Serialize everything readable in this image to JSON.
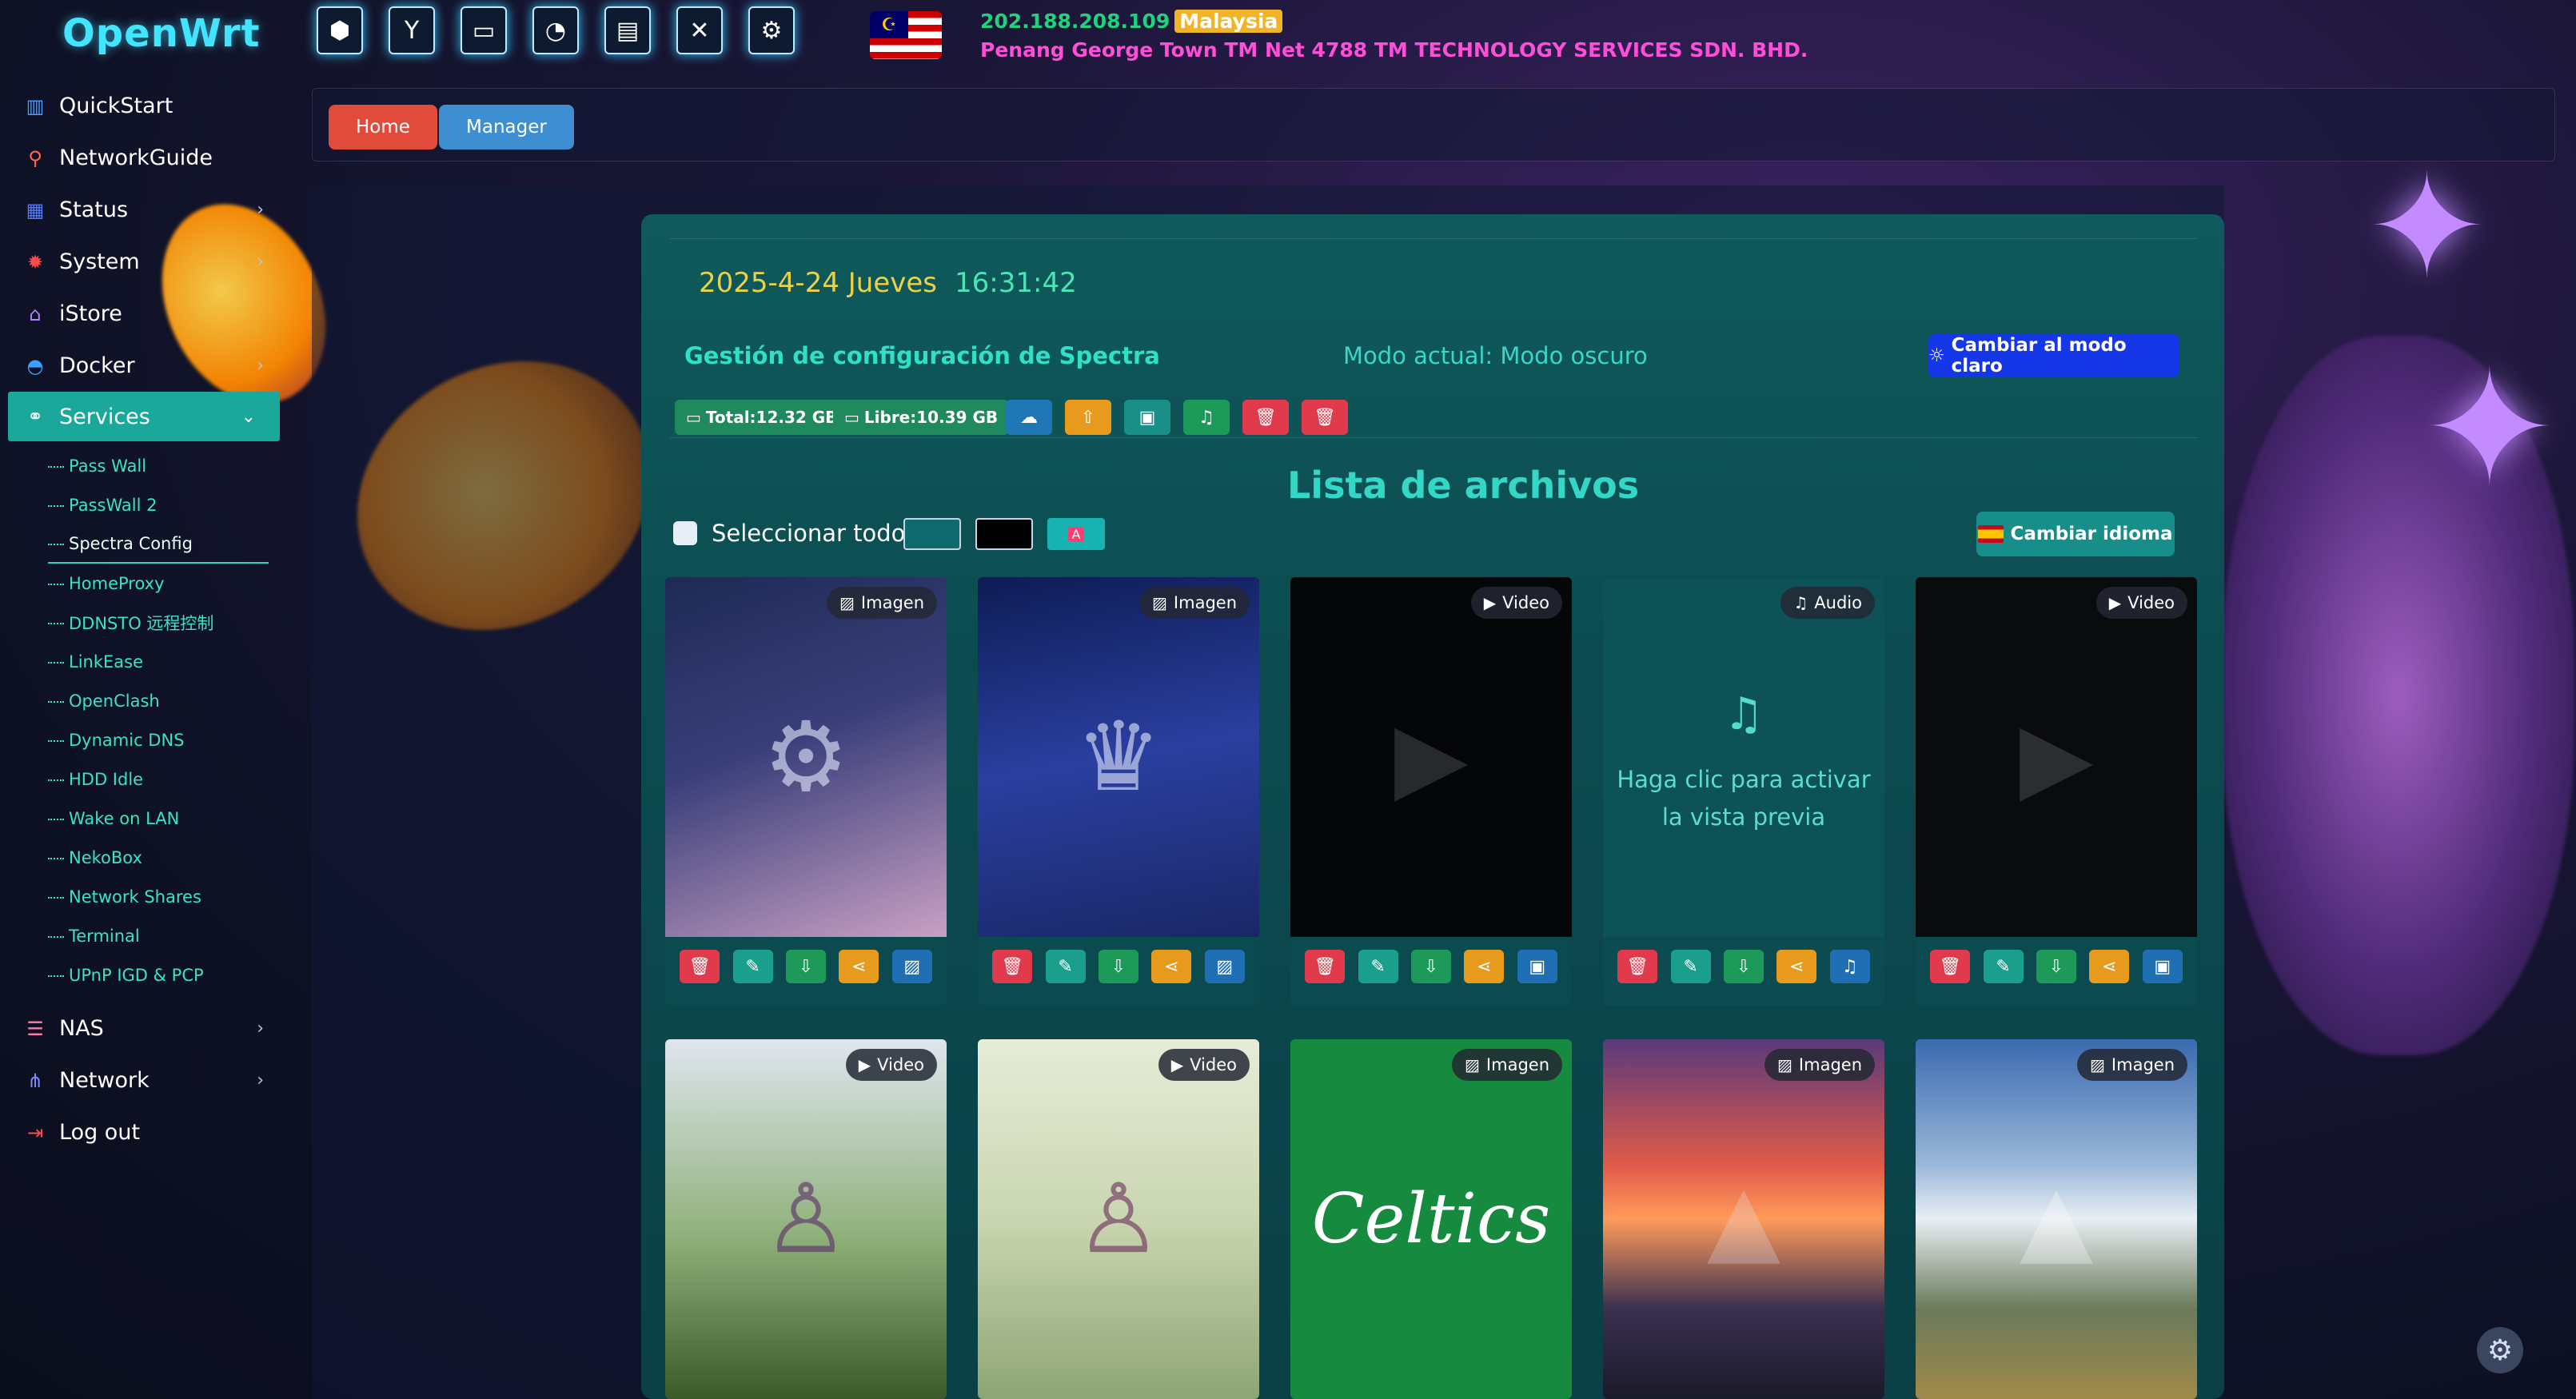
{
  "brand": "OpenWrt",
  "quick_icons": [
    "chart-icon",
    "yacd-icon",
    "folder-icon",
    "speed-icon",
    "window-icon",
    "tools-icon",
    "gear-icon"
  ],
  "ip_info": {
    "ip": "202.188.208.109",
    "country": "Malaysia",
    "isp": "Penang George Town TM Net 4788 TM TECHNOLOGY SERVICES SDN. BHD."
  },
  "sidebar": {
    "items": [
      {
        "label": "QuickStart",
        "icon": "dashboard-icon"
      },
      {
        "label": "NetworkGuide",
        "icon": "guide-icon"
      },
      {
        "label": "Status",
        "icon": "grid-icon"
      },
      {
        "label": "System",
        "icon": "cog-icon"
      },
      {
        "label": "iStore",
        "icon": "store-icon"
      },
      {
        "label": "Docker",
        "icon": "docker-icon"
      },
      {
        "label": "Services",
        "icon": "services-icon"
      },
      {
        "label": "NAS",
        "icon": "database-icon"
      },
      {
        "label": "Network",
        "icon": "network-icon"
      },
      {
        "label": "Log out",
        "icon": "logout-icon"
      }
    ],
    "services_sub": [
      "Pass Wall",
      "PassWall 2",
      "Spectra Config",
      "HomeProxy",
      "DDNSTO 远程控制",
      "LinkEase",
      "OpenClash",
      "Dynamic DNS",
      "HDD Idle",
      "Wake on LAN",
      "NekoBox",
      "Network Shares",
      "Terminal",
      "UPnP IGD & PCP"
    ]
  },
  "breadcrumb": {
    "home": "Home",
    "manager": "Manager"
  },
  "panel": {
    "date": "2025-4-24 Jueves",
    "time": "16:31:42",
    "config_title": "Gestión de configuración de Spectra",
    "mode_text": "Modo actual: Modo oscuro",
    "light_mode_button": "Cambiar al modo claro",
    "total_badge": "Total:12.32 GB",
    "free_badge": "Libre:10.39 GB",
    "list_title": "Lista de archivos",
    "select_all": "Seleccionar todo",
    "lang_button": "Cambiar idioma",
    "audio_hint": "Haga clic para activar la vista previa",
    "celtics_text": "Celtics"
  },
  "colors": {
    "accent": "#1aa89a",
    "brand": "#42e5ff",
    "panel": "#0c4b50",
    "delete": "#e03a4c",
    "share": "#e89a1d",
    "download": "#1d9a5a"
  },
  "cards": [
    {
      "type": "Imagen",
      "type_icon": "image-icon",
      "preview_icon": "image-preview-icon"
    },
    {
      "type": "Imagen",
      "type_icon": "image-icon",
      "preview_icon": "image-preview-icon"
    },
    {
      "type": "Video",
      "type_icon": "play-icon",
      "preview_icon": "video-preview-icon"
    },
    {
      "type": "Audio",
      "type_icon": "music-icon",
      "preview_icon": "audio-preview-icon"
    },
    {
      "type": "Video",
      "type_icon": "play-icon",
      "preview_icon": "video-preview-icon"
    },
    {
      "type": "Video",
      "type_icon": "play-icon"
    },
    {
      "type": "Video",
      "type_icon": "play-icon"
    },
    {
      "type": "Imagen",
      "type_icon": "image-icon"
    },
    {
      "type": "Imagen",
      "type_icon": "image-icon"
    },
    {
      "type": "Imagen",
      "type_icon": "image-icon"
    }
  ]
}
